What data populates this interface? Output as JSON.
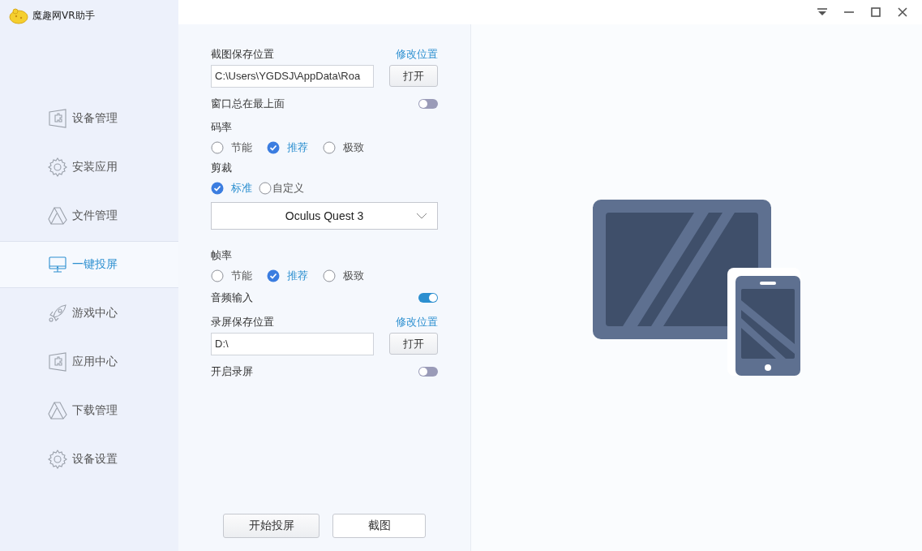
{
  "app": {
    "title": "魔趣网VR助手"
  },
  "sidebar": {
    "items": [
      {
        "label": "设备管理",
        "kind": "puzzle",
        "selected": false
      },
      {
        "label": "安装应用",
        "kind": "gear",
        "selected": false
      },
      {
        "label": "文件管理",
        "kind": "triangle",
        "selected": false
      },
      {
        "label": "一键投屏",
        "kind": "monitor",
        "selected": true
      },
      {
        "label": "游戏中心",
        "kind": "rocket",
        "selected": false
      },
      {
        "label": "应用中心",
        "kind": "puzzle",
        "selected": false
      },
      {
        "label": "下载管理",
        "kind": "triangle",
        "selected": false
      },
      {
        "label": "设备设置",
        "kind": "gear",
        "selected": false
      }
    ]
  },
  "settings": [
    {
      "kind": "path",
      "label": "截图保存位置",
      "link": "修改位置",
      "value": "C:\\Users\\YGDSJ\\AppData\\Roa",
      "button": "打开"
    },
    {
      "kind": "toggle",
      "label": "窗口总在最上面",
      "on": false
    },
    {
      "kind": "radio",
      "label": "码率",
      "options": [
        {
          "label": "节能",
          "selected": false
        },
        {
          "label": "推荐",
          "selected": true
        },
        {
          "label": "极致",
          "selected": false
        }
      ]
    },
    {
      "kind": "radio",
      "label": "剪裁",
      "options": [
        {
          "label": "标准",
          "selected": true
        },
        {
          "label": "自定义",
          "selected": false
        }
      ]
    },
    {
      "kind": "dropdown",
      "value": "Oculus Quest 3"
    },
    {
      "kind": "radio",
      "label": "帧率",
      "options": [
        {
          "label": "节能",
          "selected": false
        },
        {
          "label": "推荐",
          "selected": true
        },
        {
          "label": "极致",
          "selected": false
        }
      ]
    },
    {
      "kind": "toggle",
      "label": "音频输入",
      "on": true
    },
    {
      "kind": "path",
      "label": "录屏保存位置",
      "link": "修改位置",
      "value": "D:\\",
      "button": "打开"
    },
    {
      "kind": "toggle",
      "label": "开启录屏",
      "on": false
    }
  ],
  "actions": [
    "开始投屏",
    "截图"
  ]
}
